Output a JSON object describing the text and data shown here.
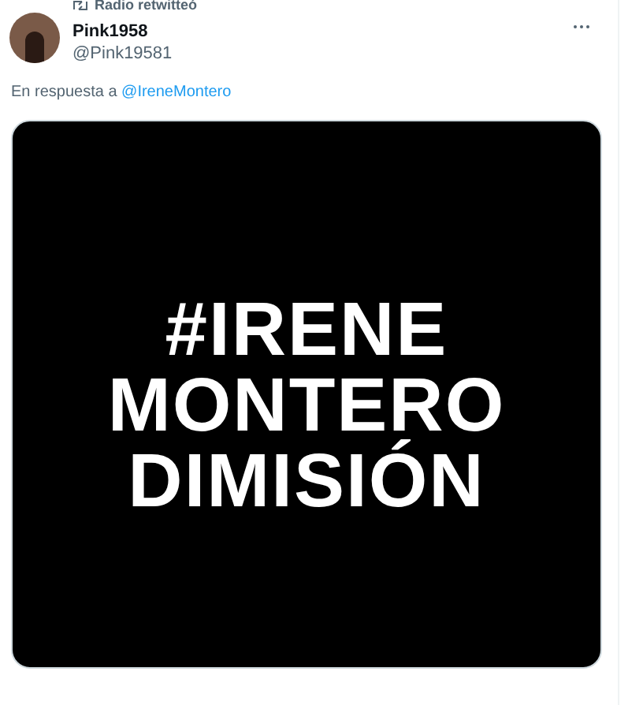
{
  "retweet": {
    "label": "Radio retwitteó"
  },
  "tweet": {
    "name": "Pink1958",
    "handle": "@Pink19581",
    "reply_prefix": "En respuesta a",
    "reply_to": "@IreneMontero",
    "media": {
      "lines": [
        "#IRENE",
        "MONTERO",
        "DIMISIÓN"
      ]
    }
  }
}
